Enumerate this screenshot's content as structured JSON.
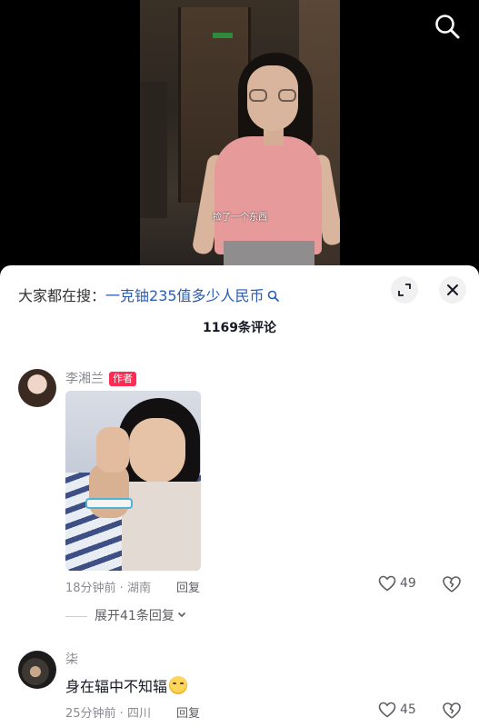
{
  "video": {
    "subtitle": "捡了一个东西"
  },
  "trending": {
    "prefix": "大家都在搜：",
    "term": "一克铀235值多少人民币"
  },
  "comments_header": {
    "count_label": "1169条评论"
  },
  "comments": [
    {
      "username": "李湘兰",
      "author_tag": "作者",
      "time_location": "18分钟前 · 湖南",
      "reply_label": "回复",
      "likes": "49",
      "expand_label": "展开41条回复"
    },
    {
      "username": "柒",
      "text": "身在辐中不知辐",
      "time_location": "25分钟前 · 四川",
      "reply_label": "回复",
      "likes": "45"
    }
  ],
  "icons": {
    "search": "search-icon",
    "expand": "expand-icon",
    "close": "close-icon",
    "heart": "heart-icon",
    "dislike": "broken-heart-icon",
    "chevron": "chevron-down-icon",
    "emoji": "smiling-emoji-icon"
  },
  "colors": {
    "accent_link": "#2b5cb4",
    "author_tag": "#fe2c55",
    "muted_text": "#8a8b91"
  }
}
